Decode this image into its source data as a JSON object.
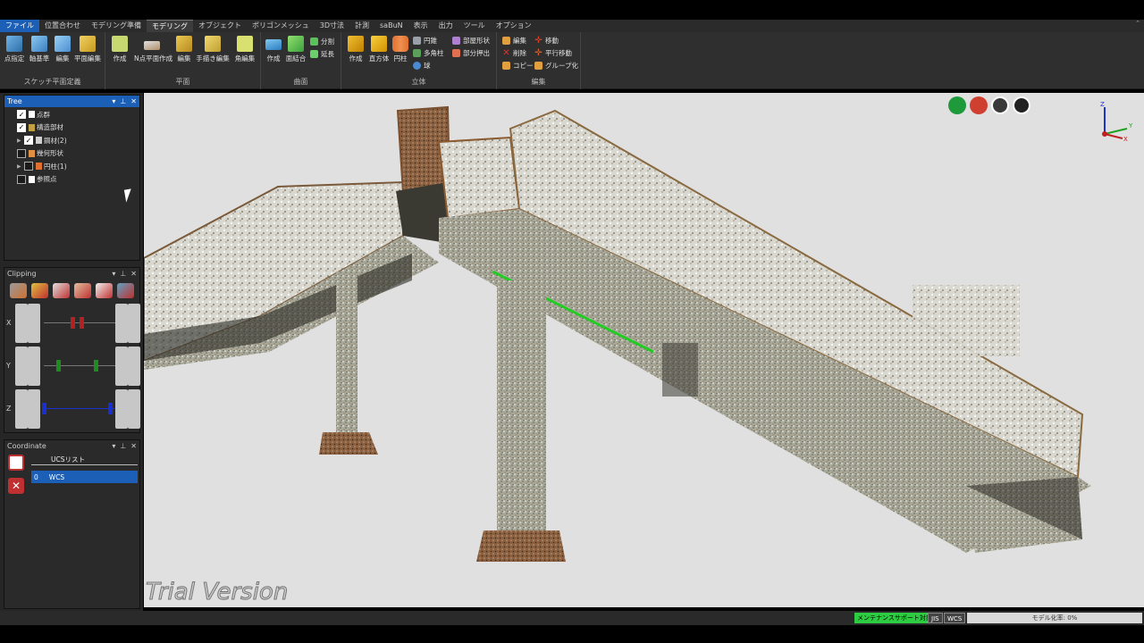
{
  "menu": {
    "items": [
      "ファイル",
      "位置合わせ",
      "モデリング準備",
      "モデリング",
      "オブジェクト",
      "ポリゴンメッシュ",
      "3D寸法",
      "計測",
      "saBuN",
      "表示",
      "出力",
      "ツール",
      "オプション"
    ],
    "active": "モデリング"
  },
  "ribbon": {
    "sketch": {
      "label": "スケッチ平面定義",
      "buttons": [
        "点指定",
        "軸基準",
        "編集",
        "平面編集"
      ]
    },
    "plane": {
      "label": "平面",
      "buttons": [
        "作成",
        "N点平面作成",
        "編集",
        "手描き編集",
        "角編集"
      ]
    },
    "surface": {
      "label": "曲面",
      "buttons": [
        "作成",
        "面結合"
      ],
      "small": [
        "分割",
        "延長"
      ]
    },
    "solid": {
      "label": "立体",
      "buttons": [
        "作成",
        "直方体",
        "円柱"
      ],
      "small_col1": [
        "円錐",
        "多角柱",
        "球"
      ],
      "small_col2": [
        "部屋形状",
        "部分押出"
      ]
    },
    "edit": {
      "label": "編集",
      "small_col1": [
        "編集",
        "削除",
        "コピー"
      ],
      "small_col2": [
        "移動",
        "平行移動",
        "グループ化"
      ]
    }
  },
  "tree_panel": {
    "title": "Tree",
    "items": [
      {
        "label": "点群",
        "checked": true,
        "level": 0,
        "arrow": false,
        "icon": "points-icon"
      },
      {
        "label": "構造部材",
        "checked": true,
        "level": 0,
        "arrow": false,
        "icon": "structure-icon"
      },
      {
        "label": "鋼材(2)",
        "checked": true,
        "level": 1,
        "arrow": true,
        "icon": "steel-icon"
      },
      {
        "label": "幾何形状",
        "checked": false,
        "level": 0,
        "arrow": false,
        "icon": "geometry-icon"
      },
      {
        "label": "円柱(1)",
        "checked": false,
        "level": 1,
        "arrow": true,
        "icon": "cylinder-icon"
      },
      {
        "label": "参照点",
        "checked": false,
        "level": 0,
        "arrow": false,
        "icon": "points-icon"
      }
    ]
  },
  "clipping_panel": {
    "title": "Clipping",
    "axes": [
      "X",
      "Y",
      "Z"
    ]
  },
  "coordinate_panel": {
    "title": "Coordinate",
    "header": "UCSリスト",
    "rows": [
      {
        "index": "0",
        "name": "WCS"
      }
    ]
  },
  "viewport": {
    "watermark": "Trial Version",
    "axis_labels": [
      "Z",
      "Y",
      "X"
    ]
  },
  "status": {
    "maintenance": "メンテナンスサポート対象",
    "jis": "JIS",
    "wcs": "WCS",
    "modeling_rate": "モデル化率: 0%"
  },
  "colors": {
    "accent": "#1c5fb6",
    "maintenance_badge": "#2ecc40",
    "clip_x": "#b22222",
    "clip_y": "#1e8c1e",
    "clip_z": "#1a2fd0"
  }
}
